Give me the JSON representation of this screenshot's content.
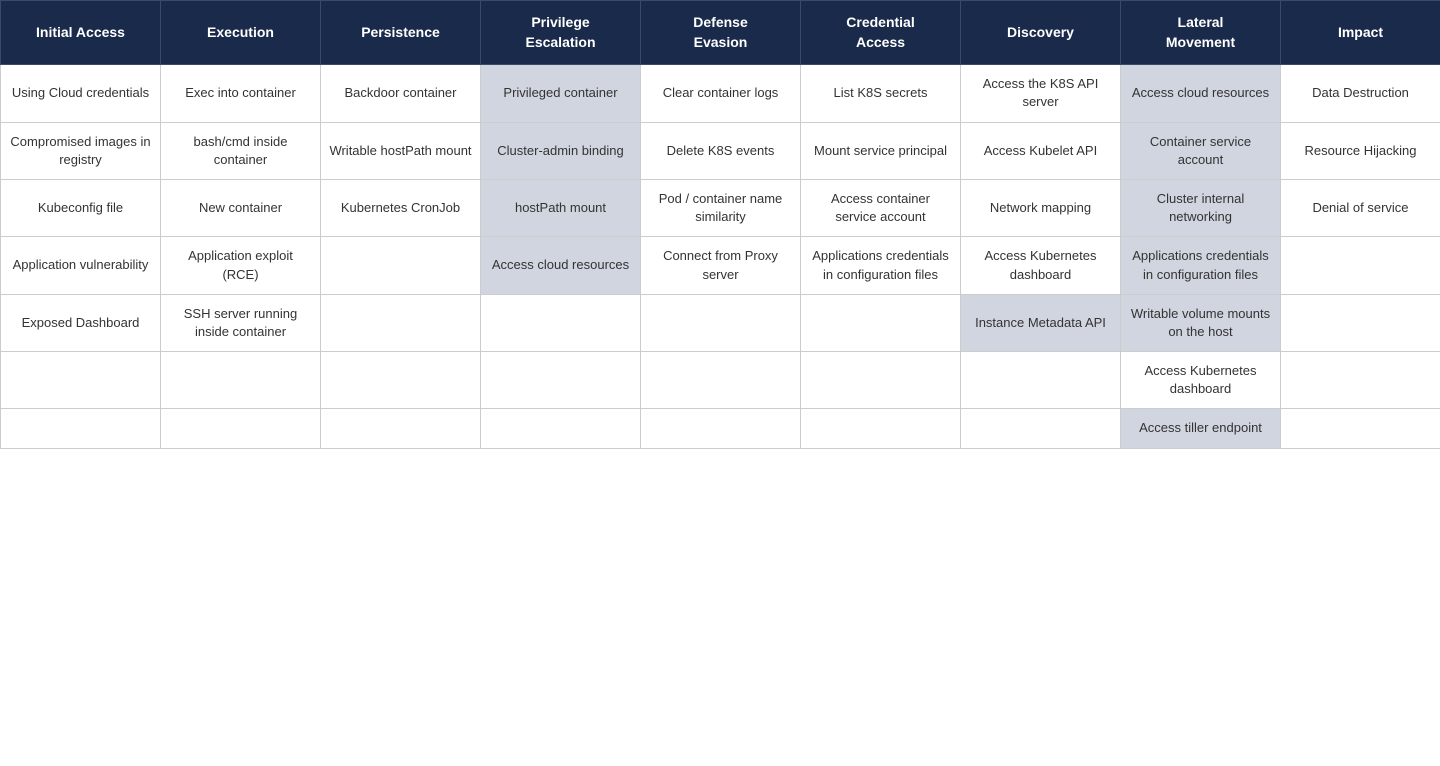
{
  "headers": [
    {
      "id": "initial-access",
      "label": "Initial Access"
    },
    {
      "id": "execution",
      "label": "Execution"
    },
    {
      "id": "persistence",
      "label": "Persistence"
    },
    {
      "id": "privilege-escalation",
      "label": "Privilege Escalation"
    },
    {
      "id": "defense-evasion",
      "label": "Defense Evasion"
    },
    {
      "id": "credential-access",
      "label": "Credential Access"
    },
    {
      "id": "discovery",
      "label": "Discovery"
    },
    {
      "id": "lateral-movement",
      "label": "Lateral Movement"
    },
    {
      "id": "impact",
      "label": "Impact"
    }
  ],
  "rows": [
    {
      "cells": [
        {
          "text": "Using Cloud credentials",
          "shaded": false
        },
        {
          "text": "Exec into container",
          "shaded": false
        },
        {
          "text": "Backdoor container",
          "shaded": false
        },
        {
          "text": "Privileged container",
          "shaded": true
        },
        {
          "text": "Clear container logs",
          "shaded": false
        },
        {
          "text": "List K8S secrets",
          "shaded": false
        },
        {
          "text": "Access the K8S API server",
          "shaded": false
        },
        {
          "text": "Access cloud resources",
          "shaded": true
        },
        {
          "text": "Data Destruction",
          "shaded": false
        }
      ]
    },
    {
      "cells": [
        {
          "text": "Compromised images in registry",
          "shaded": false
        },
        {
          "text": "bash/cmd inside container",
          "shaded": false
        },
        {
          "text": "Writable hostPath mount",
          "shaded": false
        },
        {
          "text": "Cluster-admin binding",
          "shaded": true
        },
        {
          "text": "Delete K8S events",
          "shaded": false
        },
        {
          "text": "Mount service principal",
          "shaded": false
        },
        {
          "text": "Access Kubelet API",
          "shaded": false
        },
        {
          "text": "Container service account",
          "shaded": true
        },
        {
          "text": "Resource Hijacking",
          "shaded": false
        }
      ]
    },
    {
      "cells": [
        {
          "text": "Kubeconfig file",
          "shaded": false
        },
        {
          "text": "New container",
          "shaded": false
        },
        {
          "text": "Kubernetes CronJob",
          "shaded": false
        },
        {
          "text": "hostPath mount",
          "shaded": true
        },
        {
          "text": "Pod / container name similarity",
          "shaded": false
        },
        {
          "text": "Access container service account",
          "shaded": false
        },
        {
          "text": "Network mapping",
          "shaded": false
        },
        {
          "text": "Cluster internal networking",
          "shaded": true
        },
        {
          "text": "Denial of service",
          "shaded": false
        }
      ]
    },
    {
      "cells": [
        {
          "text": "Application vulnerability",
          "shaded": false
        },
        {
          "text": "Application exploit (RCE)",
          "shaded": false
        },
        {
          "text": "",
          "empty": true
        },
        {
          "text": "Access cloud resources",
          "shaded": true
        },
        {
          "text": "Connect from Proxy server",
          "shaded": false
        },
        {
          "text": "Applications credentials in configuration files",
          "shaded": false
        },
        {
          "text": "Access Kubernetes dashboard",
          "shaded": false
        },
        {
          "text": "Applications credentials in configuration files",
          "shaded": true
        },
        {
          "text": "",
          "empty": true
        }
      ]
    },
    {
      "cells": [
        {
          "text": "Exposed Dashboard",
          "shaded": false
        },
        {
          "text": "SSH server running inside container",
          "shaded": false
        },
        {
          "text": "",
          "empty": true
        },
        {
          "text": "",
          "empty": true
        },
        {
          "text": "",
          "empty": true
        },
        {
          "text": "",
          "empty": true
        },
        {
          "text": "Instance Metadata API",
          "shaded": true
        },
        {
          "text": "Writable volume mounts on the host",
          "shaded": true
        },
        {
          "text": "",
          "empty": true
        }
      ]
    },
    {
      "cells": [
        {
          "text": "",
          "empty": true
        },
        {
          "text": "",
          "empty": true
        },
        {
          "text": "",
          "empty": true
        },
        {
          "text": "",
          "empty": true
        },
        {
          "text": "",
          "empty": true
        },
        {
          "text": "",
          "empty": true
        },
        {
          "text": "",
          "empty": true
        },
        {
          "text": "Access Kubernetes dashboard",
          "shaded": false
        },
        {
          "text": "",
          "empty": true
        }
      ]
    },
    {
      "cells": [
        {
          "text": "",
          "empty": true
        },
        {
          "text": "",
          "empty": true
        },
        {
          "text": "",
          "empty": true
        },
        {
          "text": "",
          "empty": true
        },
        {
          "text": "",
          "empty": true
        },
        {
          "text": "",
          "empty": true
        },
        {
          "text": "",
          "empty": true
        },
        {
          "text": "Access tiller endpoint",
          "shaded": true
        },
        {
          "text": "",
          "empty": true
        }
      ]
    }
  ]
}
